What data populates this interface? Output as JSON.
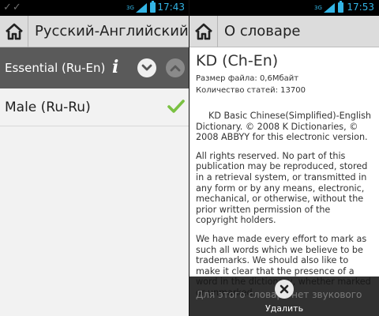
{
  "left": {
    "statusbar": {
      "time": "17:43",
      "network": "3G"
    },
    "titlebar": {
      "title": "Русский-Английский"
    },
    "selected_row": {
      "label": "Essential (Ru-En)"
    },
    "items": [
      {
        "label": "Male (Ru-Ru)",
        "checked": true
      }
    ]
  },
  "right": {
    "statusbar": {
      "time": "17:53",
      "network": "3G"
    },
    "titlebar": {
      "title": "О словаре"
    },
    "dictionary": {
      "name": "KD (Ch-En)",
      "file_size": "Размер файла: 0,6Мбайт",
      "entries": "Количество статей: 13700",
      "description": "KD Basic Chinese(Simplified)-English Dictionary. © 2008 K Dictionaries, © 2008 ABBYY for this electronic version.",
      "rights": "All rights reserved. No part of this publication may be reproduced, stored in a retrieval system, or transmitted in any form or by any means, electronic, mechanical, or otherwise, without the prior written permission of the copyright holders.",
      "trademarks": "We have made every effort to mark as such all words which we believe to be trademarks. We should also like to make it clear that the presence of a word in the dictionary, whether marked or unmarked"
    },
    "delete_bar": {
      "label": "Удалить",
      "overlay_text": "Для этого словаря нет звукового"
    }
  },
  "colors": {
    "accent": "#33b5e5",
    "check": "#7ac142",
    "selected_row": "#5a5a5a",
    "titlebar": "#dcdcdc"
  }
}
